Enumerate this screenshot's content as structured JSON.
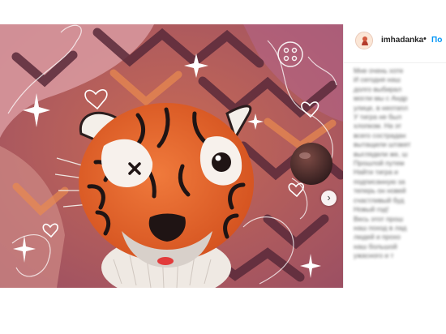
{
  "post": {
    "username": "imhadanka",
    "separator": "•",
    "follow_label": "По",
    "next_icon": "chevron-right-icon",
    "caption_lines": [
      "Мне очень хоте",
      "И сегодня наш",
      "долго выбирал",
      "могли мы с Андр",
      "улице, в неотапл",
      "У тигра не был",
      "хлопком. На эт",
      "всего сострадан",
      "вытащили штакет",
      "выглядели же, ш",
      "Прошлой путем",
      "Найти тигра и",
      "подписанную за",
      "теперь он новей",
      "счастливый буд",
      "Новый год!",
      "Весь этот прош",
      "наш поход в лад",
      "людей и прохо",
      "наш большой",
      "ужасного и т"
    ]
  },
  "colors": {
    "follow": "#0095f6",
    "username": "#262626",
    "tiger_orange": "#e8602c",
    "background_rose": "#b85f57"
  }
}
